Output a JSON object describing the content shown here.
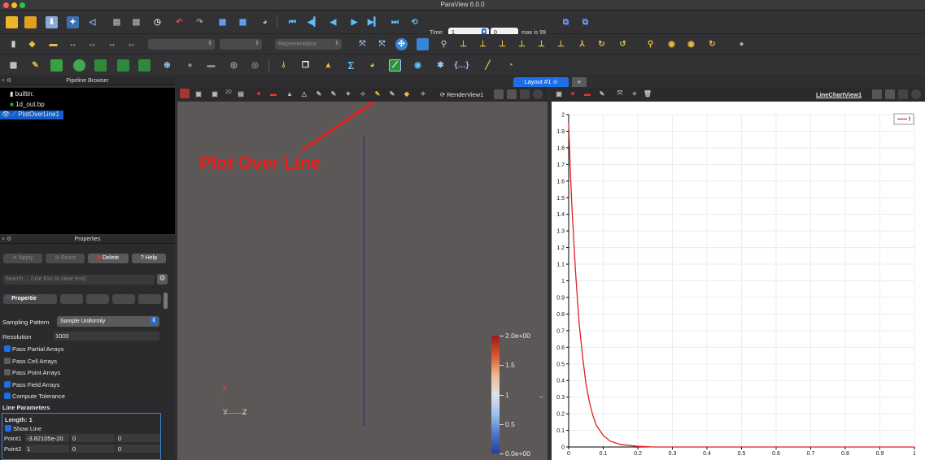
{
  "window": {
    "title": "ParaView 6.0.0"
  },
  "time": {
    "label": "Time:",
    "value": "1",
    "index": "0",
    "max_text": "max is 99"
  },
  "toolbar2": {
    "representation": "Representation"
  },
  "pipeline": {
    "header": "Pipeline Browser",
    "items": [
      {
        "label": "builtin:"
      },
      {
        "label": "1d_out.bp"
      },
      {
        "label": "PlotOverLine1"
      }
    ]
  },
  "properties": {
    "header": "Properties",
    "apply": "Apply",
    "reset": "Reset",
    "delete": "Delete",
    "help": "Help",
    "search_placeholder": "Search ... (use Esc to clear text)",
    "tab_properties": "Propertie",
    "sampling_label": "Sampling Pattern",
    "sampling_value": "Sample Uniformly",
    "resolution_label": "Resolution",
    "resolution_value": "1000",
    "checks": [
      {
        "label": "Pass Partial Arrays",
        "checked": true
      },
      {
        "label": "Pass Cell Arrays",
        "checked": false
      },
      {
        "label": "Pass Point Arrays",
        "checked": false
      },
      {
        "label": "Pass Field Arrays",
        "checked": true
      },
      {
        "label": "Compute Tolerance",
        "checked": true
      }
    ],
    "line_params": "Line Parameters",
    "length": "Length: 1",
    "show_line": "Show Line",
    "point1_label": "Point1",
    "point1": [
      "-3.82105e-20",
      "0",
      "0"
    ],
    "point2_label": "Point2",
    "point2": [
      "1",
      "0",
      "0"
    ]
  },
  "layout_tab": "Layout #1",
  "render_view": {
    "name": "RenderView1",
    "annotation": "Plot Over Line",
    "colorbar_ticks": [
      "2.0e+00",
      "1.5",
      "1",
      "0.5",
      "0.0e+00"
    ],
    "axes": {
      "x": "X",
      "y": "Y",
      "z": "Z"
    }
  },
  "chart_view": {
    "name": "LineChartView1",
    "legend": "f"
  },
  "chart_data": {
    "type": "line",
    "series": [
      {
        "name": "f",
        "color": "#e02020",
        "x": [
          0,
          0.005,
          0.01,
          0.02,
          0.03,
          0.04,
          0.05,
          0.06,
          0.07,
          0.08,
          0.1,
          0.12,
          0.15,
          0.2,
          0.25,
          0.3,
          0.5,
          0.7,
          1.0
        ],
        "y": [
          1.95,
          1.65,
          1.42,
          1.05,
          0.75,
          0.55,
          0.38,
          0.27,
          0.19,
          0.13,
          0.07,
          0.035,
          0.015,
          0.004,
          0.0,
          0.0,
          0.0,
          0.0,
          0.0
        ]
      }
    ],
    "xlim": [
      0,
      1
    ],
    "ylim": [
      0,
      2
    ],
    "xticks": [
      "0",
      "0.1",
      "0.2",
      "0.3",
      "0.4",
      "0.5",
      "0.6",
      "0.7",
      "0.8",
      "0.9",
      "1"
    ],
    "yticks": [
      "0",
      "0.1",
      "0.2",
      "0.3",
      "0.4",
      "0.5",
      "0.6",
      "0.7",
      "0.8",
      "0.9",
      "1",
      "1.1",
      "1.2",
      "1.3",
      "1.4",
      "1.5",
      "1.6",
      "1.7",
      "1.8",
      "1.9",
      "2"
    ],
    "grid": true,
    "legend": "top-right"
  }
}
